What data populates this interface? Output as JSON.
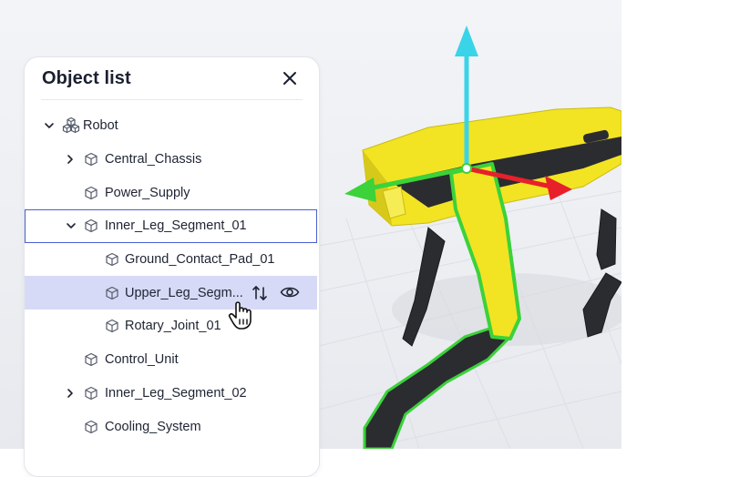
{
  "panel": {
    "title": "Object list",
    "close_icon": "close-icon"
  },
  "tree": [
    {
      "label": "Robot",
      "depth": 0,
      "expander": "expanded",
      "icon": "group-icon"
    },
    {
      "label": "Central_Chassis",
      "depth": 1,
      "expander": "collapsed",
      "icon": "cube-icon"
    },
    {
      "label": "Power_Supply",
      "depth": 1,
      "expander": "none",
      "icon": "cube-icon"
    },
    {
      "label": "Inner_Leg_Segment_01",
      "depth": 1,
      "expander": "expanded",
      "icon": "cube-icon",
      "state": "focused"
    },
    {
      "label": "Ground_Contact_Pad_01",
      "depth": 2,
      "expander": "none",
      "icon": "cube-icon"
    },
    {
      "label": "Upper_Leg_Segm...",
      "depth": 2,
      "expander": "none",
      "icon": "cube-icon",
      "state": "hovered",
      "actions": [
        "move-icon",
        "eye-icon"
      ]
    },
    {
      "label": "Rotary_Joint_01",
      "depth": 2,
      "expander": "none",
      "icon": "cube-icon"
    },
    {
      "label": "Control_Unit",
      "depth": 1,
      "expander": "none",
      "icon": "cube-icon"
    },
    {
      "label": "Inner_Leg_Segment_02",
      "depth": 1,
      "expander": "collapsed",
      "icon": "cube-icon"
    },
    {
      "label": "Cooling_System",
      "depth": 1,
      "expander": "none",
      "icon": "cube-icon"
    }
  ],
  "cursor": "hand-pointer-icon",
  "colors": {
    "focus_outline": "#4a5fd0",
    "hover_row": "#d7daf6",
    "gizmo_y": "#3ad4e8",
    "gizmo_x": "#e8202a",
    "gizmo_z": "#3bd23a",
    "robot_body": "#f2e423",
    "selection_outline": "#3bd23a"
  }
}
